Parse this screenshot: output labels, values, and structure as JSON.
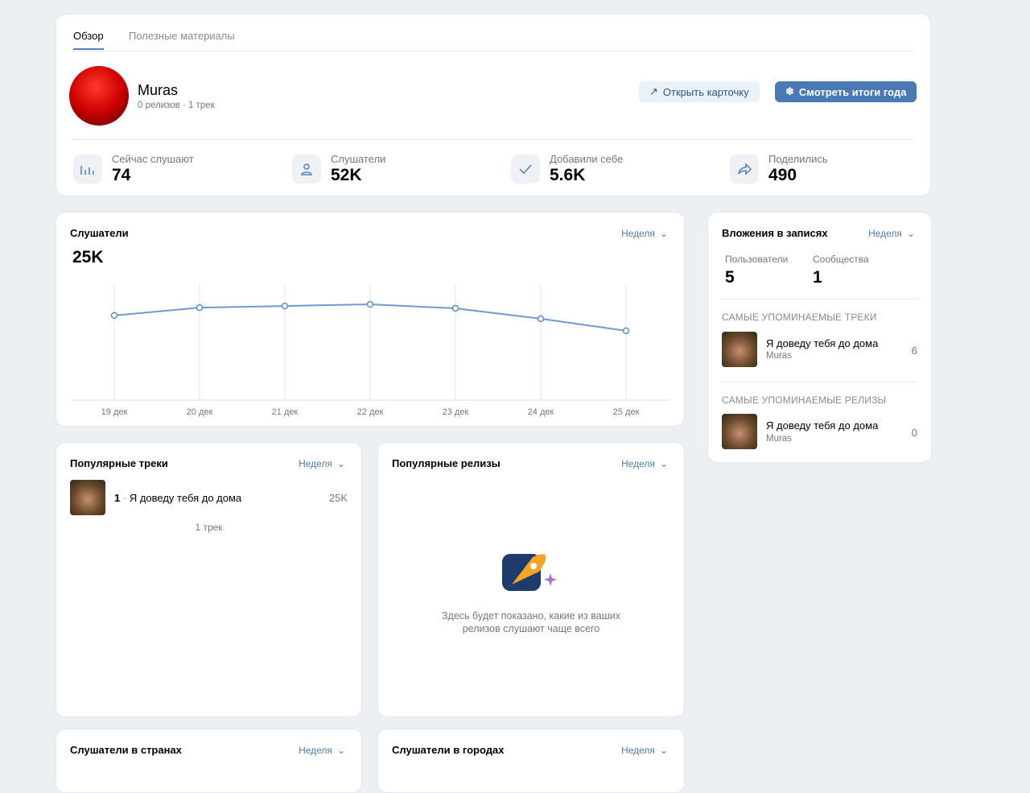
{
  "tabs": [
    "Обзор",
    "Полезные материалы"
  ],
  "artist": {
    "name": "Muras",
    "meta": "0 релизов · 1 трек"
  },
  "buttons": {
    "open_card": "Открыть карточку",
    "year_summary": "Смотреть итоги года"
  },
  "stats": [
    {
      "label": "Сейчас слушают",
      "value": "74",
      "icon": "bar-chart-icon"
    },
    {
      "label": "Слушатели",
      "value": "52K",
      "icon": "users-icon"
    },
    {
      "label": "Добавили себе",
      "value": "5.6K",
      "icon": "check-icon"
    },
    {
      "label": "Поделились",
      "value": "490",
      "icon": "share-icon"
    }
  ],
  "listeners_card": {
    "title": "Слушатели",
    "period": "Неделя",
    "total": "25K"
  },
  "chart_data": {
    "type": "line",
    "title": "Слушатели",
    "categories": [
      "19 дек",
      "20 дек",
      "21 дек",
      "22 дек",
      "23 дек",
      "24 дек",
      "25 дек"
    ],
    "values": [
      3.65,
      3.99,
      4.06,
      4.13,
      3.96,
      3.51,
      2.99
    ],
    "ylim": [
      0,
      5
    ],
    "ylabel": "",
    "xlabel": "",
    "grid": "vertical"
  },
  "attachments": {
    "title": "Вложения в записях",
    "period": "Неделя",
    "users_label": "Пользователи",
    "users": "5",
    "communities_label": "Сообщества",
    "communities": "1",
    "top_tracks_label": "САМЫЕ УПОМИНАЕМЫЕ ТРЕКИ",
    "top_track": {
      "title": "Я доведу тебя до дома",
      "artist": "Muras",
      "count": "6"
    },
    "top_releases_label": "САМЫЕ УПОМИНАЕМЫЕ РЕЛИЗЫ",
    "top_release": {
      "title": "Я доведу тебя до дома",
      "artist": "Muras",
      "count": "0"
    }
  },
  "popular_tracks": {
    "title": "Популярные треки",
    "period": "Неделя",
    "rank": "1",
    "track": "Я доведу тебя до дома",
    "plays": "25K",
    "footer": "1 трек"
  },
  "popular_releases": {
    "title": "Популярные релизы",
    "period": "Неделя",
    "empty_text": "Здесь будет показано, какие из ваших релизов слушают чаще всего"
  },
  "countries": {
    "title": "Слушатели в странах",
    "period": "Неделя"
  },
  "cities": {
    "title": "Слушатели в городах",
    "period": "Неделя"
  }
}
